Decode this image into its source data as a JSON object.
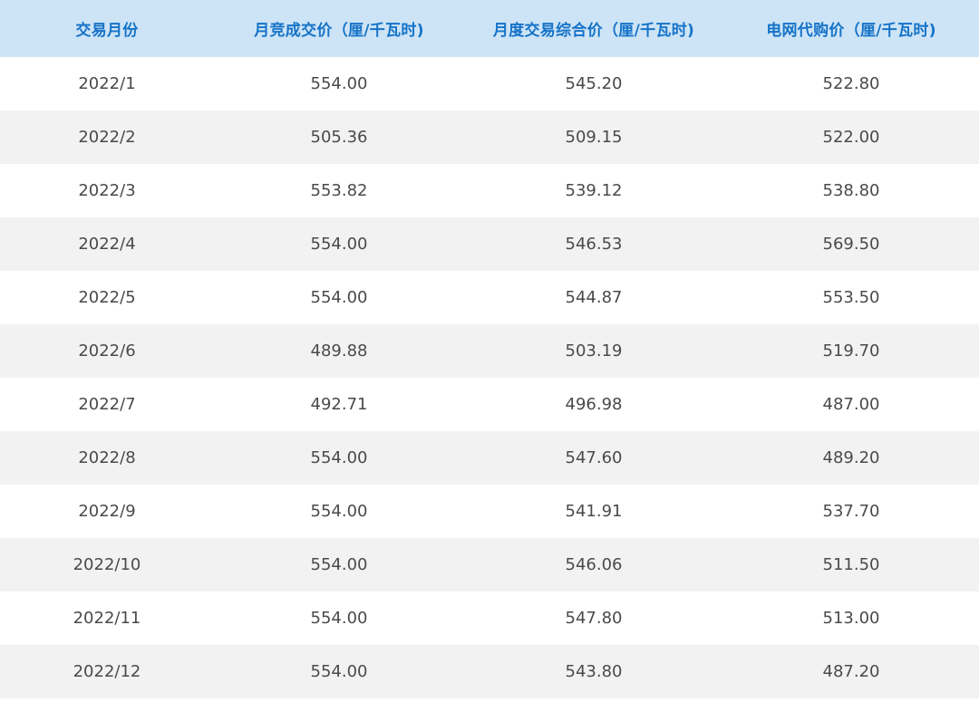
{
  "table": {
    "headers": [
      "交易月份",
      "月竞成交价（厘/千瓦时)",
      "月度交易综合价（厘/千瓦时)",
      "电网代购价（厘/千瓦时)"
    ],
    "rows": [
      [
        "2022/1",
        "554.00",
        "545.20",
        "522.80"
      ],
      [
        "2022/2",
        "505.36",
        "509.15",
        "522.00"
      ],
      [
        "2022/3",
        "553.82",
        "539.12",
        "538.80"
      ],
      [
        "2022/4",
        "554.00",
        "546.53",
        "569.50"
      ],
      [
        "2022/5",
        "554.00",
        "544.87",
        "553.50"
      ],
      [
        "2022/6",
        "489.88",
        "503.19",
        "519.70"
      ],
      [
        "2022/7",
        "492.71",
        "496.98",
        "487.00"
      ],
      [
        "2022/8",
        "554.00",
        "547.60",
        "489.20"
      ],
      [
        "2022/9",
        "554.00",
        "541.91",
        "537.70"
      ],
      [
        "2022/10",
        "554.00",
        "546.06",
        "511.50"
      ],
      [
        "2022/11",
        "554.00",
        "547.80",
        "513.00"
      ],
      [
        "2022/12",
        "554.00",
        "543.80",
        "487.20"
      ]
    ]
  },
  "colors": {
    "header_background": "#cde4f6",
    "header_text": "#1673c8",
    "row_alt_background": "#f2f2f2",
    "cell_text": "#4a4a4a"
  }
}
